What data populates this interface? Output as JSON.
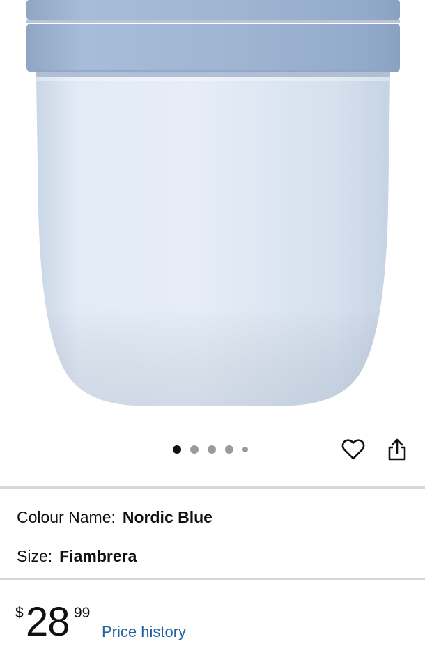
{
  "product": {
    "image_alt": "Nordic Blue lunch pot",
    "carousel": {
      "total_slides": 5,
      "active_index": 0
    },
    "icons": {
      "wishlist": "heart-icon",
      "share": "share-icon"
    }
  },
  "variations": {
    "colour": {
      "label": "Colour Name:",
      "value": "Nordic Blue"
    },
    "size": {
      "label": "Size:",
      "value": "Fiambrera"
    }
  },
  "price": {
    "symbol": "$",
    "whole": "28",
    "fraction": "99",
    "history_link": "Price history"
  },
  "colors": {
    "link": "#2162a1",
    "divider": "#d5d9d9",
    "text": "#0f1111",
    "product_lid": "#9fb5d1",
    "product_body": "#dde7f3"
  }
}
